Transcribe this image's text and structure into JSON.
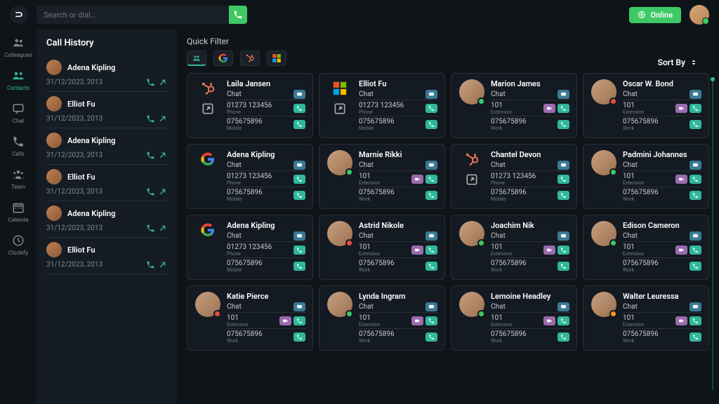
{
  "topbar": {
    "searchPlaceholder": "Search or dial...",
    "onlineLabel": "Online"
  },
  "nav": [
    {
      "id": "colleagues",
      "label": "Colleagues",
      "active": false,
      "icon": "people"
    },
    {
      "id": "contacts",
      "label": "Contacts",
      "active": true,
      "icon": "contacts"
    },
    {
      "id": "chat",
      "label": "Chat",
      "active": false,
      "icon": "chat"
    },
    {
      "id": "calls",
      "label": "Calls",
      "active": false,
      "icon": "phone"
    },
    {
      "id": "team",
      "label": "Team",
      "active": false,
      "icon": "team"
    },
    {
      "id": "calendar",
      "label": "Calenda",
      "active": false,
      "icon": "calendar"
    },
    {
      "id": "clockify",
      "label": "Clockify",
      "active": false,
      "icon": "clock"
    }
  ],
  "history": {
    "title": "Call History",
    "items": [
      {
        "name": "Adena Kipling",
        "time": "31/12/2023, 2013"
      },
      {
        "name": "Elliot Fu",
        "time": "31/12/2023, 2013"
      },
      {
        "name": "Adena Kipling",
        "time": "31/12/2023, 2013"
      },
      {
        "name": "Elliot Fu",
        "time": "31/12/2023, 2013"
      },
      {
        "name": "Adena Kipling",
        "time": "31/12/2023, 2013"
      },
      {
        "name": "Elliot Fu",
        "time": "31/12/2023, 2013"
      }
    ]
  },
  "quickFilter": {
    "label": "Quick Filter"
  },
  "sortBy": "Sort By",
  "chatLabel": "Chat",
  "phoneLabel": "Phone",
  "mobileLabel": "Mobile",
  "extLabel": "Extension",
  "workLabel": "Work",
  "contacts": [
    {
      "name": "Laila Jansen",
      "leftIcon": "hubspot",
      "ext": true,
      "rows": [
        [
          "Chat",
          "",
          "msg"
        ],
        [
          "01273 123456",
          "Phone",
          "call"
        ],
        [
          "075675896",
          "Mobile",
          "call"
        ]
      ]
    },
    {
      "name": "Elliot Fu",
      "leftIcon": "ms",
      "ext": true,
      "rows": [
        [
          "Chat",
          "",
          "msg"
        ],
        [
          "01273 123456",
          "Phone",
          "call"
        ],
        [
          "075675896",
          "Mobile",
          "call"
        ]
      ]
    },
    {
      "name": "Marion James",
      "leftIcon": "photo",
      "dot": "green",
      "rows": [
        [
          "Chat",
          "",
          "msg"
        ],
        [
          "101",
          "Extension",
          "vid,call"
        ],
        [
          "075675896",
          "Work",
          "call"
        ]
      ]
    },
    {
      "name": "Oscar W. Bond",
      "leftIcon": "photo",
      "dot": "red",
      "rows": [
        [
          "Chat",
          "",
          "msg"
        ],
        [
          "101",
          "Extension",
          "vid,call"
        ],
        [
          "075675896",
          "Work",
          "call"
        ]
      ]
    },
    {
      "name": "Adena Kipling",
      "leftIcon": "google",
      "rows": [
        [
          "Chat",
          "",
          "msg"
        ],
        [
          "01273 123456",
          "Phone",
          "call"
        ],
        [
          "075675896",
          "Mobile",
          "call"
        ]
      ]
    },
    {
      "name": "Marnie Rikki",
      "leftIcon": "photo",
      "dot": "green",
      "rows": [
        [
          "Chat",
          "",
          "msg"
        ],
        [
          "101",
          "Extension",
          "vid,call"
        ],
        [
          "075675896",
          "Work",
          "call"
        ]
      ]
    },
    {
      "name": "Chantel Devon",
      "leftIcon": "hubspot",
      "ext": true,
      "rows": [
        [
          "Chat",
          "",
          "msg"
        ],
        [
          "01273 123456",
          "Phone",
          "call"
        ],
        [
          "075675896",
          "Mobile",
          "call"
        ]
      ]
    },
    {
      "name": "Padmini Johannes",
      "leftIcon": "photo",
      "dot": "green",
      "rows": [
        [
          "Chat",
          "",
          "msg"
        ],
        [
          "101",
          "Extension",
          "vid,call"
        ],
        [
          "075675896",
          "Work",
          "call"
        ]
      ]
    },
    {
      "name": "Adena Kipling",
      "leftIcon": "google",
      "rows": [
        [
          "Chat",
          "",
          "msg"
        ],
        [
          "01273 123456",
          "Phone",
          "call"
        ],
        [
          "075675896",
          "Mobile",
          "call"
        ]
      ]
    },
    {
      "name": "Astrid Nikole",
      "leftIcon": "photo",
      "dot": "red",
      "rows": [
        [
          "Chat",
          "",
          "msg"
        ],
        [
          "101",
          "Extension",
          "vid,call"
        ],
        [
          "075675896",
          "Work",
          "call"
        ]
      ]
    },
    {
      "name": "Joachim Nik",
      "leftIcon": "photo",
      "dot": "green",
      "rows": [
        [
          "Chat",
          "",
          "msg"
        ],
        [
          "101",
          "Extension",
          "vid,call"
        ],
        [
          "075675896",
          "Work",
          "call"
        ]
      ]
    },
    {
      "name": "Edison Cameron",
      "leftIcon": "photo",
      "dot": "green",
      "rows": [
        [
          "Chat",
          "",
          "msg"
        ],
        [
          "101",
          "Extension",
          "vid,call"
        ],
        [
          "075675896",
          "Work",
          "call"
        ]
      ]
    },
    {
      "name": "Katie Pierce",
      "leftIcon": "photo",
      "dot": "red",
      "rows": [
        [
          "Chat",
          "",
          "msg"
        ],
        [
          "101",
          "Extension",
          "vid,call"
        ],
        [
          "075675896",
          "Work",
          "call"
        ]
      ]
    },
    {
      "name": "Lynda Ingram",
      "leftIcon": "photo",
      "dot": "green",
      "rows": [
        [
          "Chat",
          "",
          "msg"
        ],
        [
          "101",
          "Extension",
          "vid,call"
        ],
        [
          "075675896",
          "Work",
          "call"
        ]
      ]
    },
    {
      "name": "Lemoine Headley",
      "leftIcon": "photo",
      "dot": "green",
      "rows": [
        [
          "Chat",
          "",
          "msg"
        ],
        [
          "101",
          "Extension",
          "vid,call"
        ],
        [
          "075675896",
          "Work",
          "call"
        ]
      ]
    },
    {
      "name": "Walter Leuressa",
      "leftIcon": "photo",
      "dot": "orange",
      "rows": [
        [
          "Chat",
          "",
          "msg"
        ],
        [
          "101",
          "Extension",
          "vid,call"
        ],
        [
          "075675896",
          "Work",
          "call"
        ]
      ]
    }
  ]
}
